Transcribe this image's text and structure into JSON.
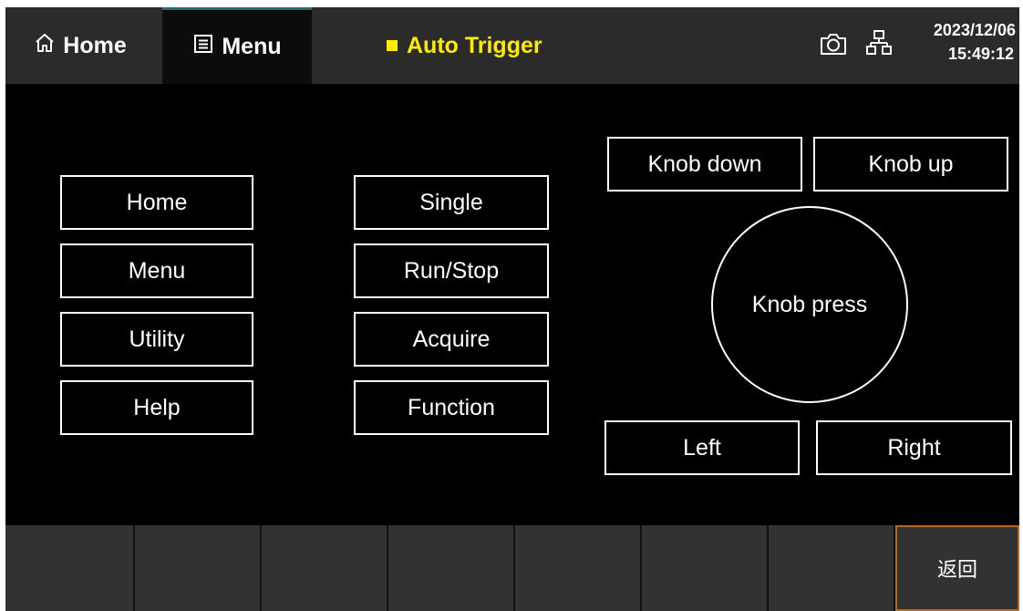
{
  "topbar": {
    "home_label": "Home",
    "menu_label": "Menu",
    "trigger_label": "Auto Trigger",
    "trigger_color": "#ffea00",
    "date": "2023/12/06",
    "time": "15:49:12",
    "icons": [
      "home-icon",
      "menu-icon",
      "camera-icon",
      "network-icon"
    ]
  },
  "keys": {
    "left_column": [
      "Home",
      "Menu",
      "Utility",
      "Help"
    ],
    "middle_column": [
      "Single",
      "Run/Stop",
      "Acquire",
      "Function"
    ],
    "knob_down": "Knob down",
    "knob_up": "Knob up",
    "knob_press": "Knob press",
    "left": "Left",
    "right": "Right"
  },
  "softkeys": [
    "",
    "",
    "",
    "",
    "",
    "",
    "",
    "返回"
  ],
  "colors": {
    "background": "#000000",
    "bar": "#2b2b2b",
    "active_softkey_border": "#b66a21",
    "active_tab_accent": "#1f6f6c"
  }
}
